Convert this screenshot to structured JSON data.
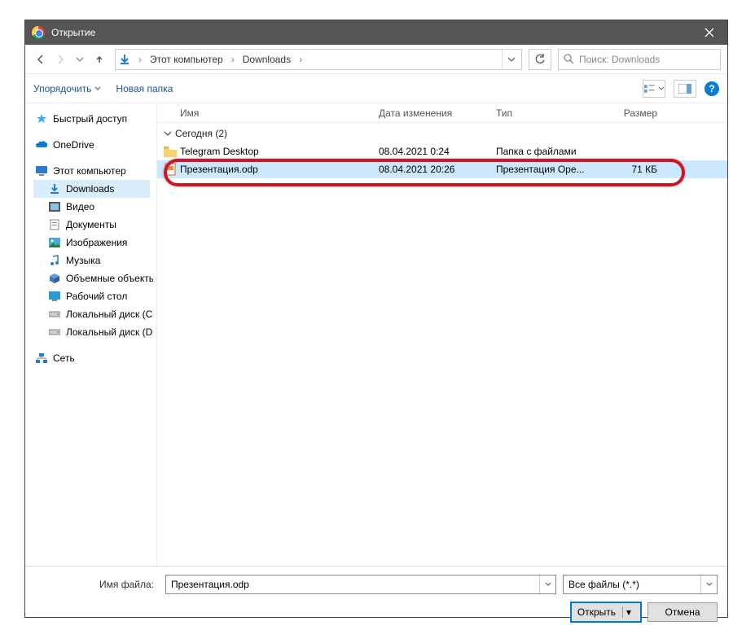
{
  "window": {
    "title": "Открытие"
  },
  "nav": {
    "crumbs": [
      "Этот компьютер",
      "Downloads"
    ]
  },
  "search": {
    "placeholder": "Поиск: Downloads"
  },
  "toolbar": {
    "organize": "Упорядочить",
    "new_folder": "Новая папка"
  },
  "tree": {
    "quick_access": "Быстрый доступ",
    "onedrive": "OneDrive",
    "this_pc": "Этот компьютер",
    "downloads": "Downloads",
    "videos": "Видео",
    "documents": "Документы",
    "pictures": "Изображения",
    "music": "Музыка",
    "objects3d": "Объемные объекты",
    "desktop": "Рабочий стол",
    "local_c": "Локальный диск (C:)",
    "local_d": "Локальный диск (D:)",
    "network": "Сеть"
  },
  "columns": {
    "name": "Имя",
    "date": "Дата изменения",
    "type": "Тип",
    "size": "Размер"
  },
  "group": {
    "label": "Сегодня (2)"
  },
  "rows": [
    {
      "name": "Telegram Desktop",
      "date": "08.04.2021 0:24",
      "type": "Папка с файлами",
      "size": ""
    },
    {
      "name": "Презентация.odp",
      "date": "08.04.2021 20:26",
      "type": "Презентация Ope...",
      "size": "71 КБ"
    }
  ],
  "footer": {
    "file_label": "Имя файла:",
    "file_value": "Презентация.odp",
    "filter": "Все файлы (*.*)",
    "open": "Открыть",
    "cancel": "Отмена"
  }
}
